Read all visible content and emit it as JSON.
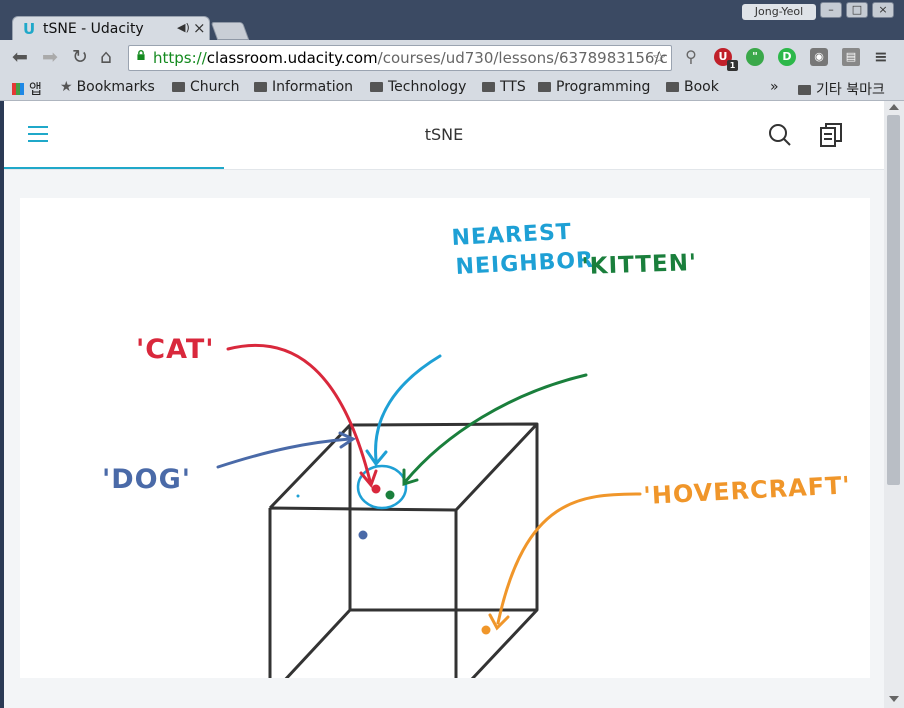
{
  "browser": {
    "tab_title": "tSNE - Udacity",
    "favicon": "U",
    "user_name": "Jong-Yeol",
    "url_scheme": "https://",
    "url_host": "classroom.udacity.com",
    "url_path": "/courses/ud730/lessons/6378983156/c",
    "extensions": [
      "magnifier-icon",
      "ublock-icon",
      "evernote-icon",
      "idm-icon",
      "camera-icon",
      "window-icon",
      "chrome-menu-icon"
    ],
    "ublock_badge": "1",
    "bookmarks": {
      "apps_label": "앱",
      "items": [
        "Bookmarks",
        "Church",
        "Information",
        "Technology",
        "TTS",
        "Programming",
        "Book"
      ],
      "overflow": "»",
      "other_label": "기타 북마크"
    }
  },
  "app": {
    "title": "tSNE",
    "progress": 0.25,
    "accent": "#1fa8c9"
  },
  "figure": {
    "labels": {
      "nearest": [
        "NEAREST",
        "NEIGHBOR"
      ],
      "kitten": "'KITTEN'",
      "cat": "'CAT'",
      "dog": "'DOG'",
      "hovercraft": "'HOVERCRAFT'"
    },
    "colors": {
      "cat": "#d9283c",
      "kitten": "#1a7f3c",
      "dog": "#4a6aa8",
      "hovercraft": "#f0962a",
      "nearest": "#1ea0d5",
      "cube": "#333333"
    }
  }
}
